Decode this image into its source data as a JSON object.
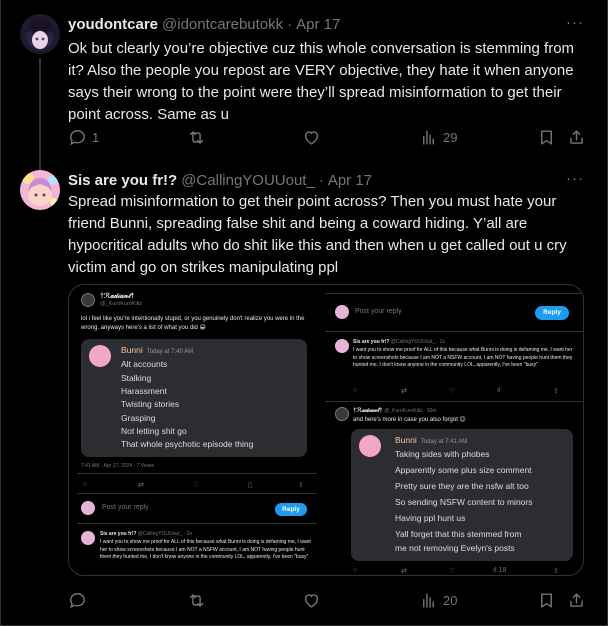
{
  "tweets": [
    {
      "name": "youdontcare",
      "handle": "@idontcarebutokk",
      "date": "Apr 17",
      "text": "Ok but clearly you’re objective cuz this whole conversation is stemming from it? Also the people you repost are VERY objective, they hate it when anyone says their wrong to the point were they’ll spread misinformation to get their point across. Same as u",
      "replies": "1",
      "views": "29"
    },
    {
      "name": "Sis are you fr!?",
      "handle": "@CallingYOUUout_",
      "date": "Apr 17",
      "text": "Spread misinformation to get their point across? Then you must hate your friend Bunni, spreading false shit and being a coward hiding. Y’all are hypocritical adults who do shit like this and then when u get called out u cry victim and go on strikes manipulating ppl",
      "views": "20"
    }
  ],
  "more_label": "···",
  "media": {
    "left": {
      "poster_name": "†ℛ𝒶𝒹𝒾𝒶𝓃𝓉†",
      "poster_handle": "@_KuroKuroKiliz",
      "post_text": "lol i feel like you're intentionally stupid, or you genuinely don't realize you were in the wrong. anyways here's a list of what you did 😁",
      "card_name": "Bunni",
      "card_time": "Today at 7:40 AM",
      "card_lines": [
        "Alt accounts",
        "Stalking",
        "Harassment",
        "Twisting stories",
        "Grasping",
        "Not letting shit go",
        "That whole psychotic episode thing"
      ],
      "meta": "7:41 AM · Apr 17, 2024 · 7 Views",
      "reply_placeholder": "Post your reply",
      "reply_button": "Reply",
      "bottom_name": "Sis are you fr!?",
      "bottom_handle": "@CallingYOUUout_ · 2s",
      "bottom_text": "I want you to show me proof for ALL of this because what Bunni is doing is defaming me, I want her to show screenshots because I am NOT a NSFW account, I am NOT having people hunt them they hunted me, I don't know anyone in the community LOL, apparently, I've been \"busy\""
    },
    "right": {
      "reply_placeholder": "Post your reply",
      "reply_button": "Reply",
      "top_name": "Sis are you fr!?",
      "top_handle": "@CallingYOUUout_ · 2s",
      "top_text": "I want you to show me proof for ALL of this because what Bunni is doing is defaming me, I want her to show screenshots because I am NOT a NSFW account, I am NOT having people hunt them they hunted me, I don't know anyone in the community LOL, apparently, I've been \"busy\"",
      "poster_name": "†ℛ𝒶𝒹𝒾𝒶𝓃𝓉†",
      "poster_handle": "@_KuroKuroKiliz · 50m",
      "post_text": "and here's more in case you also forgot 😊",
      "card_name": "Bunni",
      "card_time": "Today at 7:41 AM",
      "card_lines": [
        "Taking sides with phobes",
        "Apparently some plus size comment",
        "Pretty sure they are the nsfw alt too",
        "So sending NSFW content to minors",
        "Having ppl hunt us",
        "Yall forget that this stemmed from",
        "me not removing Evelyn's posts"
      ],
      "mini_views": "18"
    }
  },
  "icons": [
    "reply-icon",
    "retweet-icon",
    "like-icon",
    "views-icon",
    "bookmark-icon",
    "share-icon",
    "more-icon"
  ],
  "colors": {
    "background": "#000000",
    "text": "#e7e9ea",
    "muted": "#71767b",
    "accent": "#1d9bf0",
    "discord_card": "#2b2d31",
    "discord_name": "#f7c4a3"
  }
}
